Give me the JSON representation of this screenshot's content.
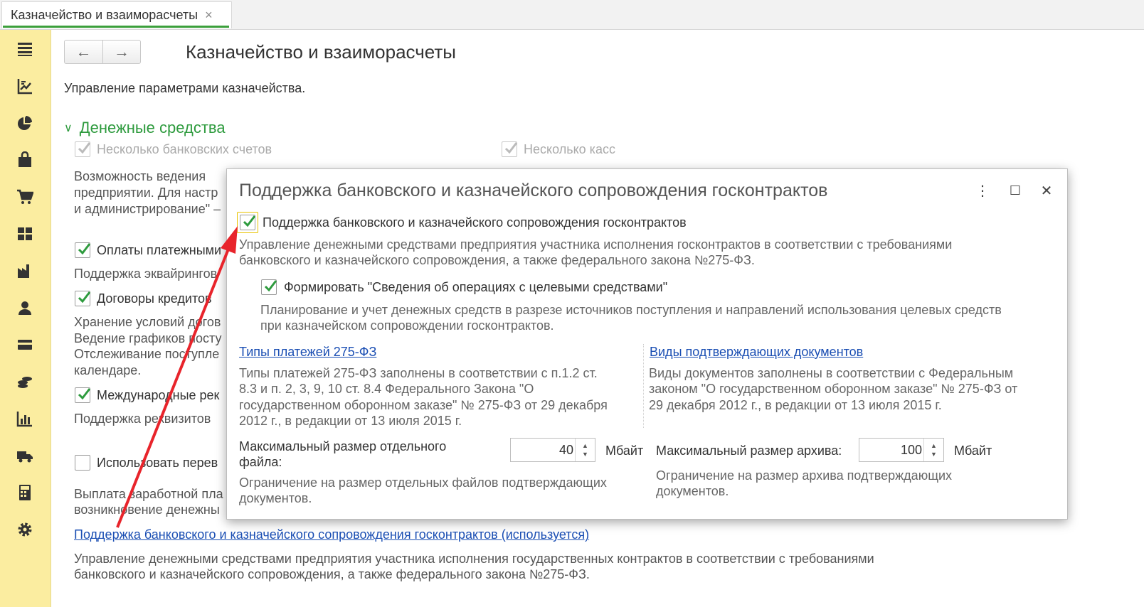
{
  "tab": {
    "label": "Казначейство и взаиморасчеты",
    "close": "×"
  },
  "nav": {
    "back": "←",
    "forward": "→"
  },
  "page": {
    "title": "Казначейство и взаиморасчеты",
    "description": "Управление параметрами казначейства."
  },
  "section": {
    "chevron": "∨",
    "title": "Денежные средства"
  },
  "options": {
    "bank_accounts": "Несколько банковских счетов",
    "cash_desks": "Несколько касс",
    "bank_desc": [
      "Возможность ведения",
      "предприятии. Для настр",
      "и администрирование\" –"
    ],
    "payment_cards": "Оплаты платежными",
    "acquiring": "Поддержка эквайрингов",
    "credit_contracts": "Договоры кредитов",
    "credit_desc": [
      "Хранение условий догов",
      "Ведение графиков посту",
      "Отслеживание поступле",
      "календаре."
    ],
    "international": "Международные рек",
    "international_desc": "Поддержка реквизитов",
    "transfer": "Использовать перев",
    "transfer_desc": [
      "Выплата заработной пла",
      "возникновение денежны"
    ],
    "gos_link": "Поддержка банковского и казначейского сопровождения госконтрактов (используется)",
    "gos_desc": [
      "Управление денежными средствами предприятия участника исполнения государственных контрактов в соответствии с требованиями",
      "банковского и казначейского сопровождения, а также федерального закона №275-ФЗ."
    ]
  },
  "dialog": {
    "title": "Поддержка банковского и казначейского сопровождения госконтрактов",
    "menu": "⋮",
    "maximize": "☐",
    "close": "✕",
    "main_cb_label": "Поддержка банковского и казначейского сопровождения госконтрактов",
    "main_desc": [
      "Управление денежными средствами предприятия участника исполнения госконтрактов в соответствии с требованиями",
      "банковского и казначейского сопровождения, а также федерального закона №275-ФЗ."
    ],
    "sub_cb_label": "Формировать \"Сведения об операциях с целевыми средствами\"",
    "sub_desc": [
      "Планирование и учет денежных средств в разрезе источников поступления и направлений использования целевых средств",
      "при казначейском сопровождении госконтрактов."
    ],
    "payment_types_link": "Типы платежей 275-ФЗ",
    "payment_types_desc": [
      "Типы платежей 275-ФЗ заполнены в соответствии с п.1.2 ст.",
      "8.3 и п. 2, 3, 9, 10 ст. 8.4 Федерального Закона \"О",
      "государственном оборонном заказе\" № 275-ФЗ от 29 декабря",
      "2012 г., в редакции от 13 июля 2015 г."
    ],
    "doc_types_link": "Виды подтверждающих документов",
    "doc_types_desc": [
      "Виды документов заполнены в соответствии с Федеральным",
      "законом \"О государственном оборонном заказе\" № 275-ФЗ от",
      "29 декабря 2012 г., в редакции от 13 июля 2015 г."
    ],
    "max_file_label": [
      "Максимальный размер отдельного",
      "файла:"
    ],
    "max_file_value": "40",
    "max_file_unit": "Мбайт",
    "max_archive_label": "Максимальный размер архива:",
    "max_archive_value": "100",
    "max_archive_unit": "Мбайт",
    "max_file_desc": [
      "Ограничение на размер отдельных файлов подтверждающих",
      "документов."
    ],
    "max_archive_desc": [
      "Ограничение на размер архива подтверждающих",
      "документов."
    ],
    "spin_up": "▲",
    "spin_down": "▼"
  },
  "colors": {
    "accent_green": "#2e9b3e",
    "link_blue": "#1a4eb3",
    "sidebar_bg": "#fbeda0",
    "arrow_red": "#e8242b"
  }
}
